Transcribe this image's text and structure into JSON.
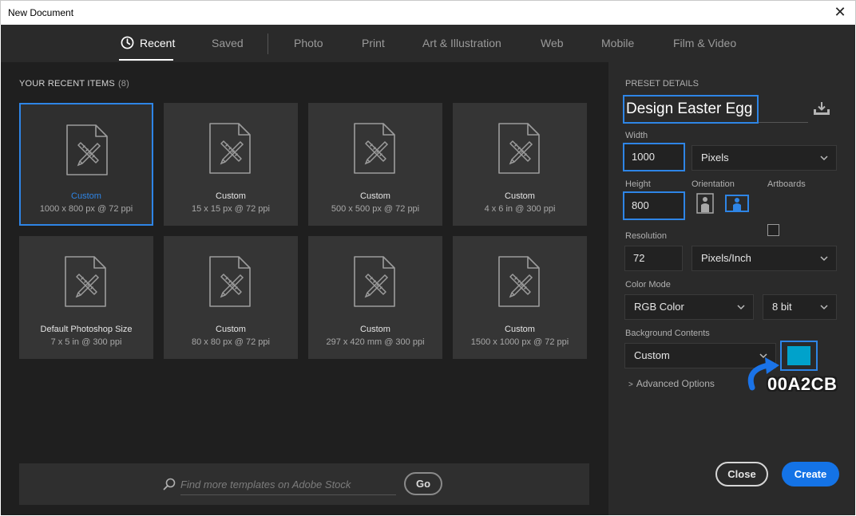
{
  "window": {
    "title": "New Document"
  },
  "tabs": [
    {
      "label": "Recent",
      "active": true
    },
    {
      "label": "Saved"
    },
    {
      "label": "Photo"
    },
    {
      "label": "Print"
    },
    {
      "label": "Art & Illustration"
    },
    {
      "label": "Web"
    },
    {
      "label": "Mobile"
    },
    {
      "label": "Film & Video"
    }
  ],
  "recent": {
    "heading": "YOUR RECENT ITEMS",
    "count": "(8)",
    "items": [
      {
        "name": "Custom",
        "dims": "1000 x 800 px @ 72 ppi",
        "selected": true
      },
      {
        "name": "Custom",
        "dims": "15 x 15 px @ 72 ppi"
      },
      {
        "name": "Custom",
        "dims": "500 x 500 px @ 72 ppi"
      },
      {
        "name": "Custom",
        "dims": "4 x 6 in @ 300 ppi"
      },
      {
        "name": "Default Photoshop Size",
        "dims": "7 x 5 in @ 300 ppi"
      },
      {
        "name": "Custom",
        "dims": "80 x 80 px @ 72 ppi"
      },
      {
        "name": "Custom",
        "dims": "297 x 420 mm @ 300 ppi"
      },
      {
        "name": "Custom",
        "dims": "1500 x 1000 px @ 72 ppi"
      }
    ]
  },
  "search": {
    "placeholder": "Find more templates on Adobe Stock",
    "go_label": "Go"
  },
  "preset": {
    "heading": "PRESET DETAILS",
    "name": "Design Easter Egg",
    "width_label": "Width",
    "width_value": "1000",
    "width_unit": "Pixels",
    "height_label": "Height",
    "height_value": "800",
    "orientation_label": "Orientation",
    "artboards_label": "Artboards",
    "resolution_label": "Resolution",
    "resolution_value": "72",
    "resolution_unit": "Pixels/Inch",
    "color_mode_label": "Color Mode",
    "color_mode": "RGB Color",
    "bit_depth": "8 bit",
    "background_label": "Background Contents",
    "background_value": "Custom",
    "background_color": "#00A2CB",
    "advanced_label": "Advanced Options"
  },
  "buttons": {
    "close": "Close",
    "create": "Create"
  },
  "annotation": {
    "text": "00A2CB"
  },
  "colors": {
    "accent": "#2e85e6",
    "create": "#1473e6",
    "annotation_arrow": "#1a73e8"
  }
}
